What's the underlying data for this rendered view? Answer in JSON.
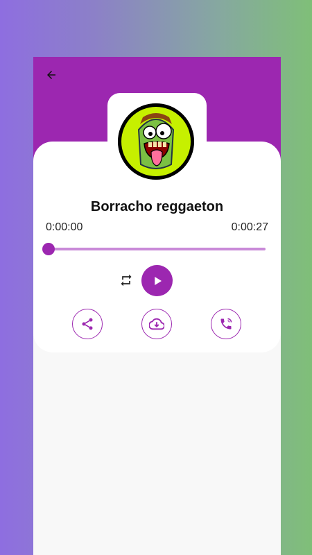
{
  "header": {
    "back_icon": "arrow-left-icon",
    "color": "#9c27b0"
  },
  "track": {
    "title": "Borracho reggaeton",
    "current_time": "0:00:00",
    "total_time": "0:00:27",
    "progress": 0.0
  },
  "controls": {
    "repeat_icon": "repeat-icon",
    "play_icon": "play-icon"
  },
  "actions": [
    {
      "name": "share",
      "icon": "share-icon"
    },
    {
      "name": "download",
      "icon": "cloud-download-icon"
    },
    {
      "name": "set-ringtone",
      "icon": "phone-ring-icon"
    }
  ],
  "colors": {
    "accent": "#9c27b0",
    "track_bg": "#c98ad8",
    "card": "#ffffff"
  }
}
